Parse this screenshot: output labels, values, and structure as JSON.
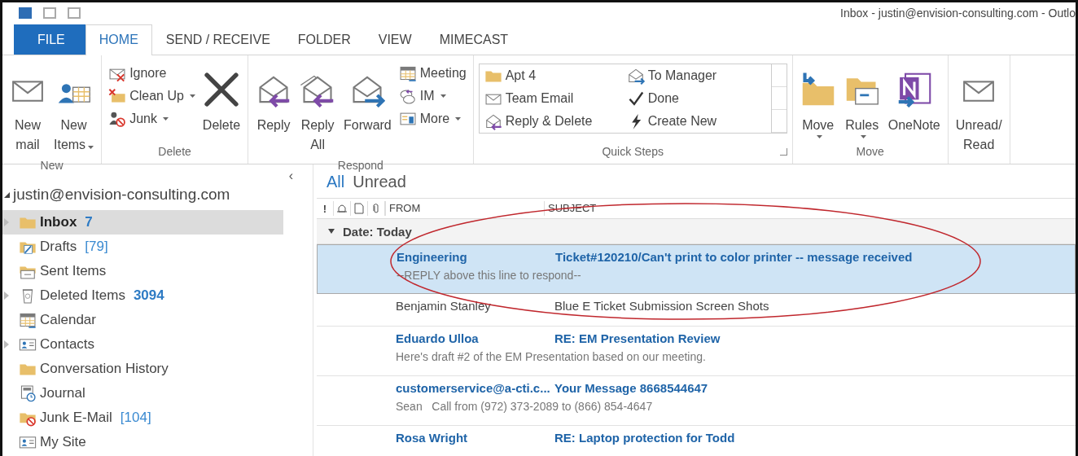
{
  "window": {
    "title": "Inbox - justin@envision-consulting.com - Outlo"
  },
  "tabs": [
    {
      "label": "FILE",
      "kind": "file",
      "selected": false
    },
    {
      "label": "HOME",
      "kind": "tab",
      "selected": true
    },
    {
      "label": "SEND / RECEIVE",
      "kind": "tab",
      "selected": false
    },
    {
      "label": "FOLDER",
      "kind": "tab",
      "selected": false
    },
    {
      "label": "VIEW",
      "kind": "tab",
      "selected": false
    },
    {
      "label": "MIMECAST",
      "kind": "tab",
      "selected": false
    }
  ],
  "ribbon": {
    "groups": [
      {
        "label": "New",
        "items": [
          {
            "kind": "large",
            "lines": [
              "New",
              "mail"
            ]
          },
          {
            "kind": "large",
            "lines": [
              "New",
              "Items"
            ],
            "dropdown": true
          }
        ]
      },
      {
        "label": "Delete",
        "items": [
          {
            "kind": "stack",
            "entries": [
              {
                "label": "Ignore"
              },
              {
                "label": "Clean Up",
                "dropdown": true
              },
              {
                "label": "Junk",
                "dropdown": true
              }
            ]
          },
          {
            "kind": "large",
            "lines": [
              "Delete"
            ]
          }
        ]
      },
      {
        "label": "Respond",
        "items": [
          {
            "kind": "large",
            "lines": [
              "Reply"
            ]
          },
          {
            "kind": "large",
            "lines": [
              "Reply",
              "All"
            ]
          },
          {
            "kind": "large",
            "lines": [
              "Forward"
            ]
          },
          {
            "kind": "stack",
            "entries": [
              {
                "label": "Meeting"
              },
              {
                "label": "IM",
                "dropdown": true
              },
              {
                "label": "More",
                "dropdown": true
              }
            ]
          }
        ]
      },
      {
        "label": "Quick Steps",
        "launcher": true,
        "items": [
          {
            "kind": "gallery",
            "entries": [
              {
                "label": "Apt 4"
              },
              {
                "label": "To Manager"
              },
              {
                "label": "Team Email"
              },
              {
                "label": "Done"
              },
              {
                "label": "Reply & Delete"
              },
              {
                "label": "Create New"
              }
            ]
          }
        ]
      },
      {
        "label": "Move",
        "items": [
          {
            "kind": "large",
            "lines": [
              "Move"
            ],
            "dropdown": true
          },
          {
            "kind": "large",
            "lines": [
              "Rules"
            ],
            "dropdown": true
          },
          {
            "kind": "large",
            "lines": [
              "OneNote"
            ]
          }
        ]
      },
      {
        "items": [
          {
            "kind": "large",
            "lines": [
              "Unread/",
              "Read"
            ]
          }
        ]
      }
    ]
  },
  "sidebar": {
    "collapse": "‹",
    "account": "justin@envision-consulting.com",
    "expanded": true,
    "folders": [
      {
        "name": "Inbox",
        "count": "7",
        "unread": true,
        "expandable": true,
        "selected": true
      },
      {
        "name": "Drafts",
        "count": "[79]",
        "unread": false,
        "expandable": false,
        "selected": false
      },
      {
        "name": "Sent Items",
        "expandable": false,
        "selected": false
      },
      {
        "name": "Deleted Items",
        "count": "3094",
        "unread": true,
        "expandable": true,
        "selected": false
      },
      {
        "name": "Calendar",
        "expandable": false,
        "selected": false
      },
      {
        "name": "Contacts",
        "expandable": true,
        "selected": false
      },
      {
        "name": "Conversation History",
        "expandable": false,
        "selected": false
      },
      {
        "name": "Journal",
        "expandable": false,
        "selected": false
      },
      {
        "name": "Junk E-Mail",
        "count": "[104]",
        "unread": false,
        "expandable": false,
        "selected": false
      },
      {
        "name": "My Site",
        "expandable": false,
        "selected": false
      }
    ]
  },
  "mail": {
    "filters": [
      {
        "label": "All",
        "selected": true
      },
      {
        "label": "Unread",
        "selected": false
      }
    ],
    "columns": [
      {
        "kind": "importance",
        "label": "!"
      },
      {
        "kind": "reminder"
      },
      {
        "kind": "type"
      },
      {
        "kind": "attachment"
      },
      {
        "kind": "from",
        "label": "FROM"
      },
      {
        "kind": "subject",
        "label": "SUBJECT"
      }
    ],
    "group": {
      "label": "Date: Today",
      "expanded": true
    },
    "messages": [
      {
        "from": "Engineering",
        "subject": "Ticket#120210/Can't print to color printer -- message received",
        "preview": "--REPLY above this line to respond--",
        "unread": true,
        "selected": true
      },
      {
        "from": "Benjamin Stanley",
        "subject": "Blue E Ticket Submission Screen Shots",
        "unread": false,
        "selected": false
      },
      {
        "from": "Eduardo Ulloa",
        "subject": "RE: EM Presentation Review",
        "preview": "Here's draft #2 of the EM Presentation based on our meeting.",
        "unread": true,
        "selected": false
      },
      {
        "from": "customerservice@a-cti.c...",
        "subject": "Your Message 8668544647",
        "preview": "Sean   Call from (972) 373-2089 to (866) 854-4647",
        "unread": true,
        "selected": false
      },
      {
        "from": "Rosa Wright",
        "subject": "RE: Laptop protection for Todd",
        "unread": true,
        "selected": false
      }
    ]
  },
  "annotation": {
    "kind": "ellipse"
  }
}
